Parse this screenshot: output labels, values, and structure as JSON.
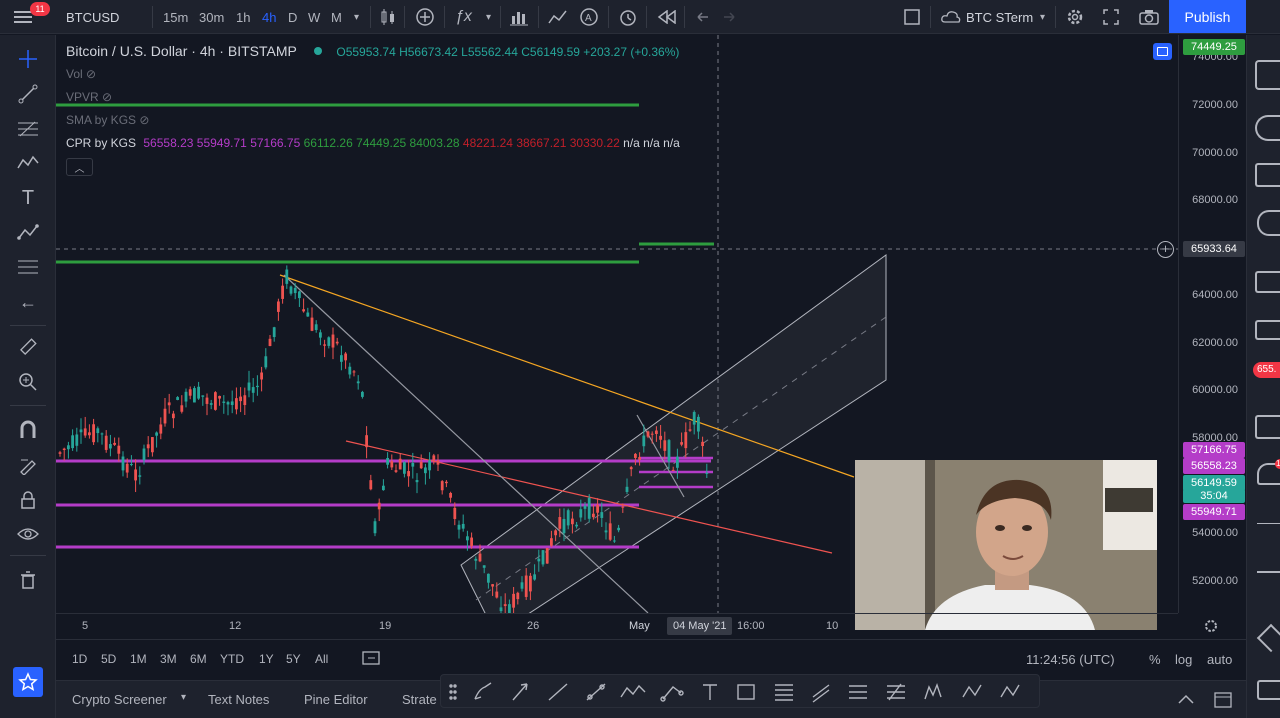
{
  "topbar": {
    "notif_count": "11",
    "symbol": "BTCUSD",
    "intervals": [
      "15m",
      "30m",
      "1h",
      "4h",
      "D",
      "W",
      "M"
    ],
    "active_interval": "4h",
    "layout_name": "BTC STerm",
    "publish_label": "Publish"
  },
  "legend": {
    "title": "Bitcoin / U.S. Dollar",
    "interval": "4h",
    "exchange": "BITSTAMP",
    "open": "O55953.74",
    "high": "H56673.42",
    "low": "L55562.44",
    "close": "C56149.59",
    "change": "+203.27 (+0.36%)"
  },
  "indicators": {
    "vol": "Vol",
    "vpvr": "VPVR",
    "sma": "SMA by KGS",
    "cpr_label": "CPR by KGS",
    "cpr_values_pink": [
      "56558.23",
      "55949.71",
      "57166.75"
    ],
    "cpr_values_green": [
      "66112.26",
      "74449.25",
      "84003.28"
    ],
    "cpr_values_red": [
      "48221.24",
      "38667.21",
      "30330.22"
    ],
    "cpr_na": "n/a n/a n/a"
  },
  "price_axis": {
    "labels": [
      "74000.00",
      "72000.00",
      "70000.00",
      "68000.00",
      "65933.64",
      "64000.00",
      "62000.00",
      "60000.00",
      "58000.00",
      "54000.00",
      "52000.00"
    ],
    "tags": {
      "top": "74449.25",
      "p1": "57166.75",
      "p2": "56558.23",
      "last": "56149.59",
      "countdown": "35:04",
      "p3": "55949.71",
      "right_cut1": "655.",
      "right_cut2": "1"
    }
  },
  "time_axis": {
    "labels": [
      "5",
      "12",
      "19",
      "26",
      "May",
      "04 May '21",
      "16:00",
      "10"
    ]
  },
  "rangebar": {
    "ranges": [
      "1D",
      "5D",
      "1M",
      "3M",
      "6M",
      "YTD",
      "1Y",
      "5Y",
      "All"
    ],
    "clock": "11:24:56 (UTC)",
    "percent": "%",
    "log": "log",
    "auto": "auto"
  },
  "bottombar": {
    "tabs": [
      "Crypto Screener",
      "Text Notes",
      "Pine Editor",
      "Strate"
    ]
  },
  "colors": {
    "up": "#26a69a",
    "down": "#ef5350",
    "pink": "#b43cc8",
    "green": "#2e9d3f",
    "orange": "#f5a623",
    "accent": "#2962ff"
  }
}
